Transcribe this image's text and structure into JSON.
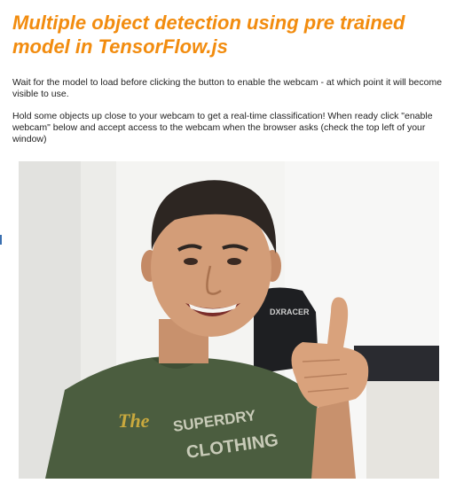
{
  "page": {
    "title": "Multiple object detection using pre trained model in TensorFlow.js",
    "intro_paragraph_1": "Wait for the model to load before clicking the button to enable the webcam - at which point it will become visible to use.",
    "intro_paragraph_2": "Hold some objects up close to your webcam to get a real-time classification! When ready click \"enable webcam\" below and accept access to the webcam when the browser asks (check the top left of your window)"
  },
  "webcam": {
    "chair_brand_text": "DXRACER",
    "shirt_print_text_1": "The",
    "shirt_print_text_2": "SUPERDRY",
    "shirt_print_text_3": "CLOTHING"
  },
  "colors": {
    "title": "#f28c0f",
    "body_text": "#222222",
    "shirt": "#4b5d3f",
    "side_marker": "#3a6fb0"
  }
}
